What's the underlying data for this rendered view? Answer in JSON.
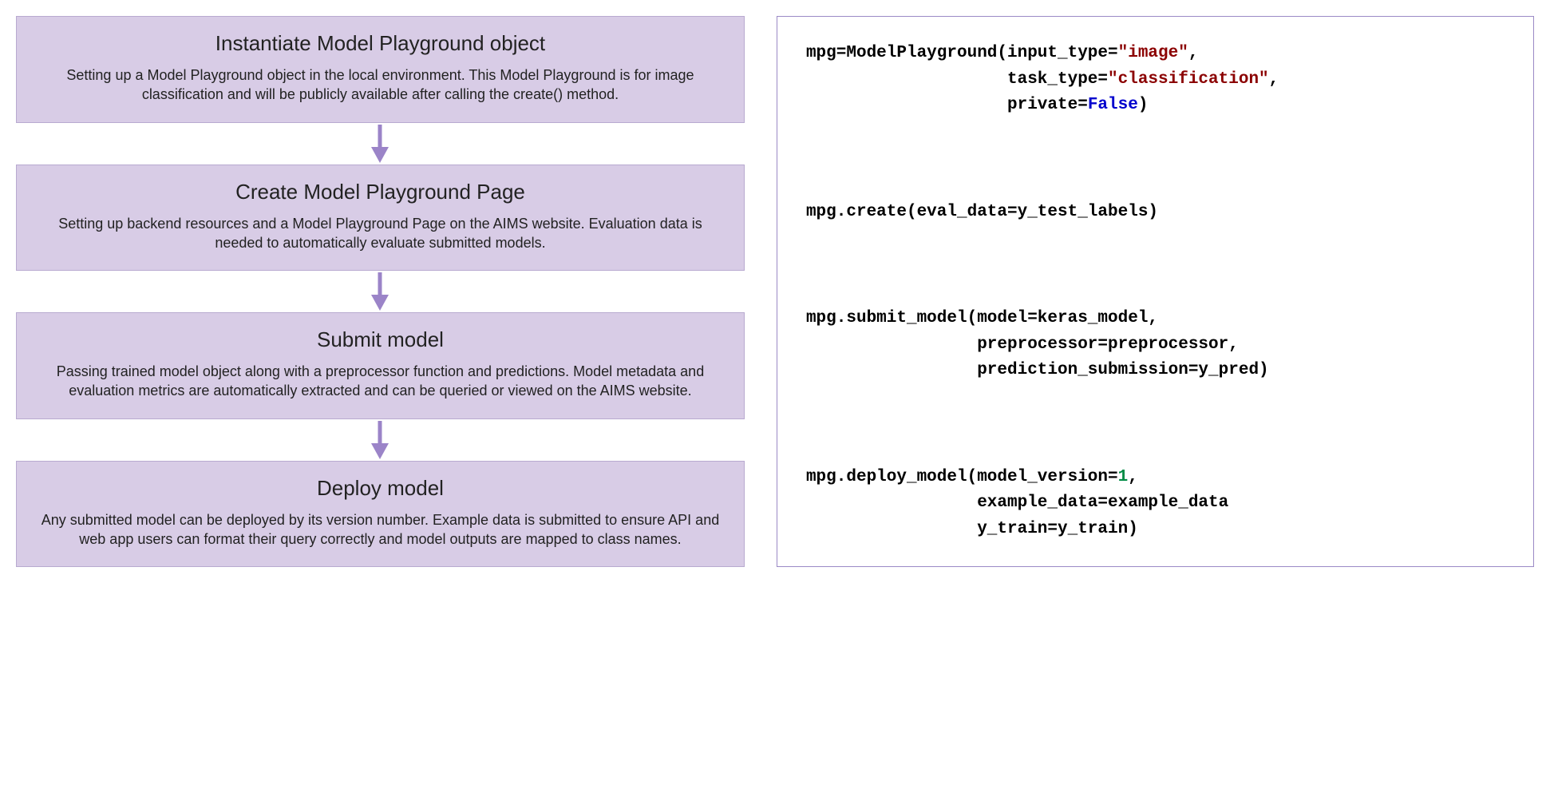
{
  "steps": [
    {
      "title": "Instantiate Model Playground object",
      "desc": "Setting up a Model Playground object in the local environment. This Model Playground is for image classification and will be publicly available after calling the create() method."
    },
    {
      "title": "Create Model Playground Page",
      "desc": "Setting up backend resources and a Model Playground Page on the AIMS website. Evaluation data is needed to automatically evaluate submitted models."
    },
    {
      "title": "Submit model",
      "desc": "Passing trained model object along with a preprocessor function and predictions. Model metadata and evaluation metrics are automatically extracted and can be queried or viewed on the AIMS website."
    },
    {
      "title": "Deploy model",
      "desc": "Any submitted model can be deployed by its version number. Example data is submitted to ensure API and web app users can format their query correctly and model outputs are mapped to class names."
    }
  ],
  "code": {
    "block1": {
      "l1a": "mpg=ModelPlayground(input_type=",
      "l1b": "\"image\"",
      "l1c": ",",
      "l2a": "                    task_type=",
      "l2b": "\"classification\"",
      "l2c": ",",
      "l3a": "                    private=",
      "l3b": "False",
      "l3c": ")"
    },
    "block2": {
      "l1": "mpg.create(eval_data=y_test_labels)"
    },
    "block3": {
      "l1": "mpg.submit_model(model=keras_model,",
      "l2": "                 preprocessor=preprocessor,",
      "l3": "                 prediction_submission=y_pred)"
    },
    "block4": {
      "l1a": "mpg.deploy_model(model_version=",
      "l1b": "1",
      "l1c": ",",
      "l2": "                 example_data=example_data",
      "l3": "                 y_train=y_train)"
    }
  }
}
